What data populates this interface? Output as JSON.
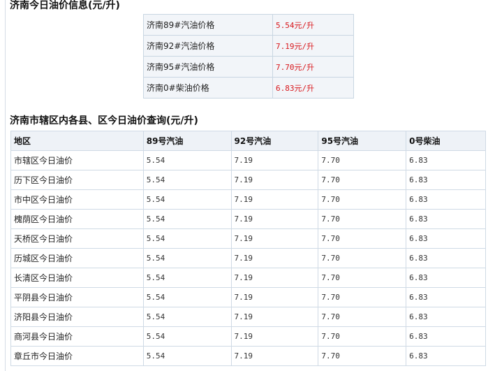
{
  "summary": {
    "title": "济南今日油价信息(元/升)",
    "rows": [
      {
        "name": "济南89#汽油价格",
        "price": "5.54元/升"
      },
      {
        "name": "济南92#汽油价格",
        "price": "7.19元/升"
      },
      {
        "name": "济南95#汽油价格",
        "price": "7.70元/升"
      },
      {
        "name": "济南0#柴油价格",
        "price": "6.83元/升"
      }
    ]
  },
  "districts": {
    "title": "济南市辖区内各县、区今日油价查询(元/升)",
    "headers": [
      "地区",
      "89号汽油",
      "92号汽油",
      "95号汽油",
      "0号柴油"
    ],
    "rows": [
      [
        "市辖区今日油价",
        "5.54",
        "7.19",
        "7.70",
        "6.83"
      ],
      [
        "历下区今日油价",
        "5.54",
        "7.19",
        "7.70",
        "6.83"
      ],
      [
        "市中区今日油价",
        "5.54",
        "7.19",
        "7.70",
        "6.83"
      ],
      [
        "槐荫区今日油价",
        "5.54",
        "7.19",
        "7.70",
        "6.83"
      ],
      [
        "天桥区今日油价",
        "5.54",
        "7.19",
        "7.70",
        "6.83"
      ],
      [
        "历城区今日油价",
        "5.54",
        "7.19",
        "7.70",
        "6.83"
      ],
      [
        "长清区今日油价",
        "5.54",
        "7.19",
        "7.70",
        "6.83"
      ],
      [
        "平阴县今日油价",
        "5.54",
        "7.19",
        "7.70",
        "6.83"
      ],
      [
        "济阳县今日油价",
        "5.54",
        "7.19",
        "7.70",
        "6.83"
      ],
      [
        "商河县今日油价",
        "5.54",
        "7.19",
        "7.70",
        "6.83"
      ],
      [
        "章丘市今日油价",
        "5.54",
        "7.19",
        "7.70",
        "6.83"
      ]
    ]
  },
  "colors": {
    "price_text": "#d8161b",
    "summary_bg": "#f2f5f9",
    "header_bg": "#eef2f7",
    "border": "#cfdae5"
  }
}
